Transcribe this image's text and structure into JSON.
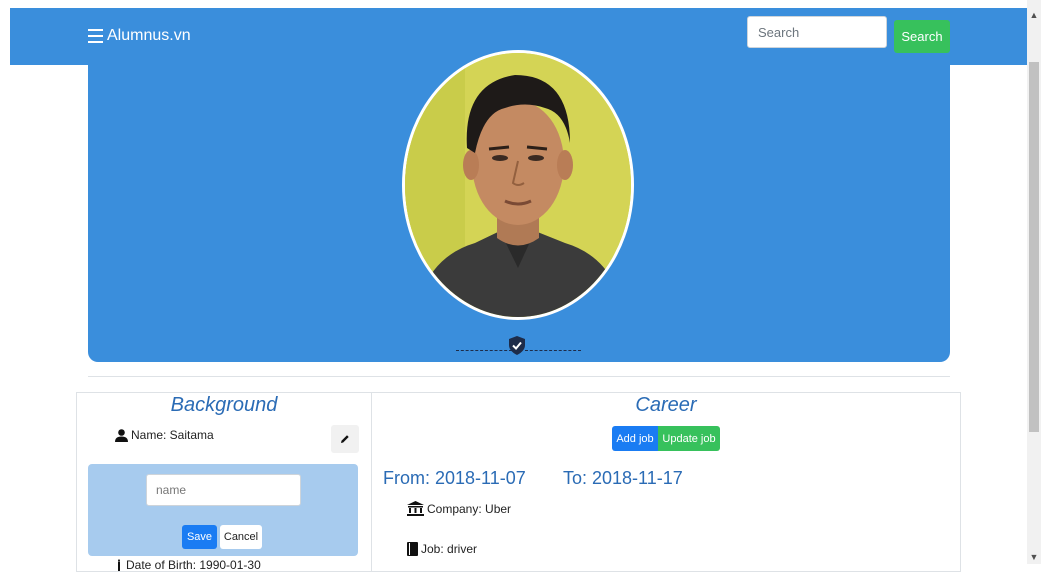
{
  "navbar": {
    "brand": "Alumnus.vn",
    "search_placeholder": "Search",
    "search_button": "Search",
    "color": "#3a8edc"
  },
  "profile": {
    "cover_color": "#3a8edc",
    "verified_icon": "shield-check-icon"
  },
  "background": {
    "title": "Background",
    "name_row": "Name: Saitama",
    "edit": {
      "input_placeholder": "name",
      "save_label": "Save",
      "cancel_label": "Cancel"
    },
    "dob_row": "Date of Birth: 1990-01-30"
  },
  "career": {
    "title": "Career",
    "add_job_label": "Add job",
    "update_job_label": "Update job",
    "from": "From: 2018-11-07",
    "to": "To: 2018-11-17",
    "company": "Company: Uber",
    "job": "Job: driver"
  },
  "colors": {
    "primary": "#1a7cf3",
    "success": "#37c15c",
    "heading": "#2a6bb5"
  }
}
